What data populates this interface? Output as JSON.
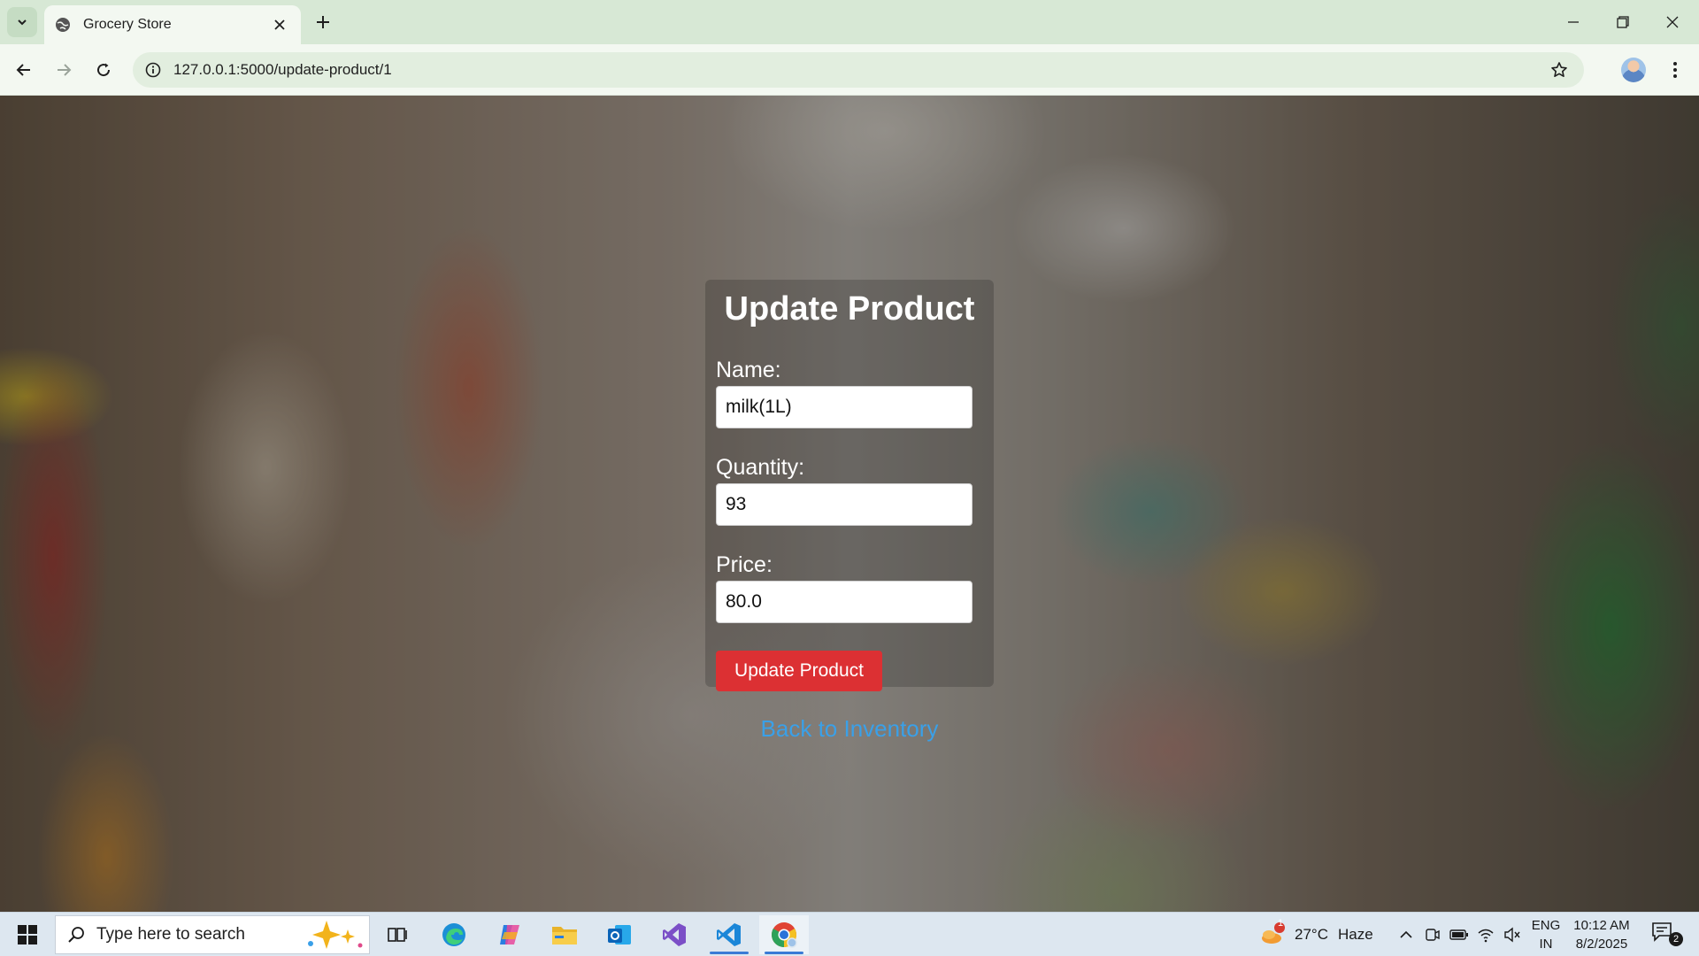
{
  "browser": {
    "tab_title": "Grocery Store",
    "url": "127.0.0.1:5000/update-product/1"
  },
  "form": {
    "heading": "Update Product",
    "name_label": "Name:",
    "name_value": "milk(1L)",
    "quantity_label": "Quantity:",
    "quantity_value": "93",
    "price_label": "Price:",
    "price_value": "80.0",
    "submit_label": "Update Product",
    "back_link": "Back to Inventory"
  },
  "taskbar": {
    "search_placeholder": "Type here to search",
    "weather_temp": "27°C",
    "weather_desc": "Haze",
    "weather_badge": "1",
    "lang_primary": "ENG",
    "lang_region": "IN",
    "time": "10:12 AM",
    "date": "8/2/2025",
    "notification_count": "2"
  },
  "colors": {
    "submit_button": "#dc3033",
    "back_link": "#3aa0e8",
    "chrome_tabbar": "#d7e8d5",
    "chrome_toolbar": "#f3f8f1"
  }
}
